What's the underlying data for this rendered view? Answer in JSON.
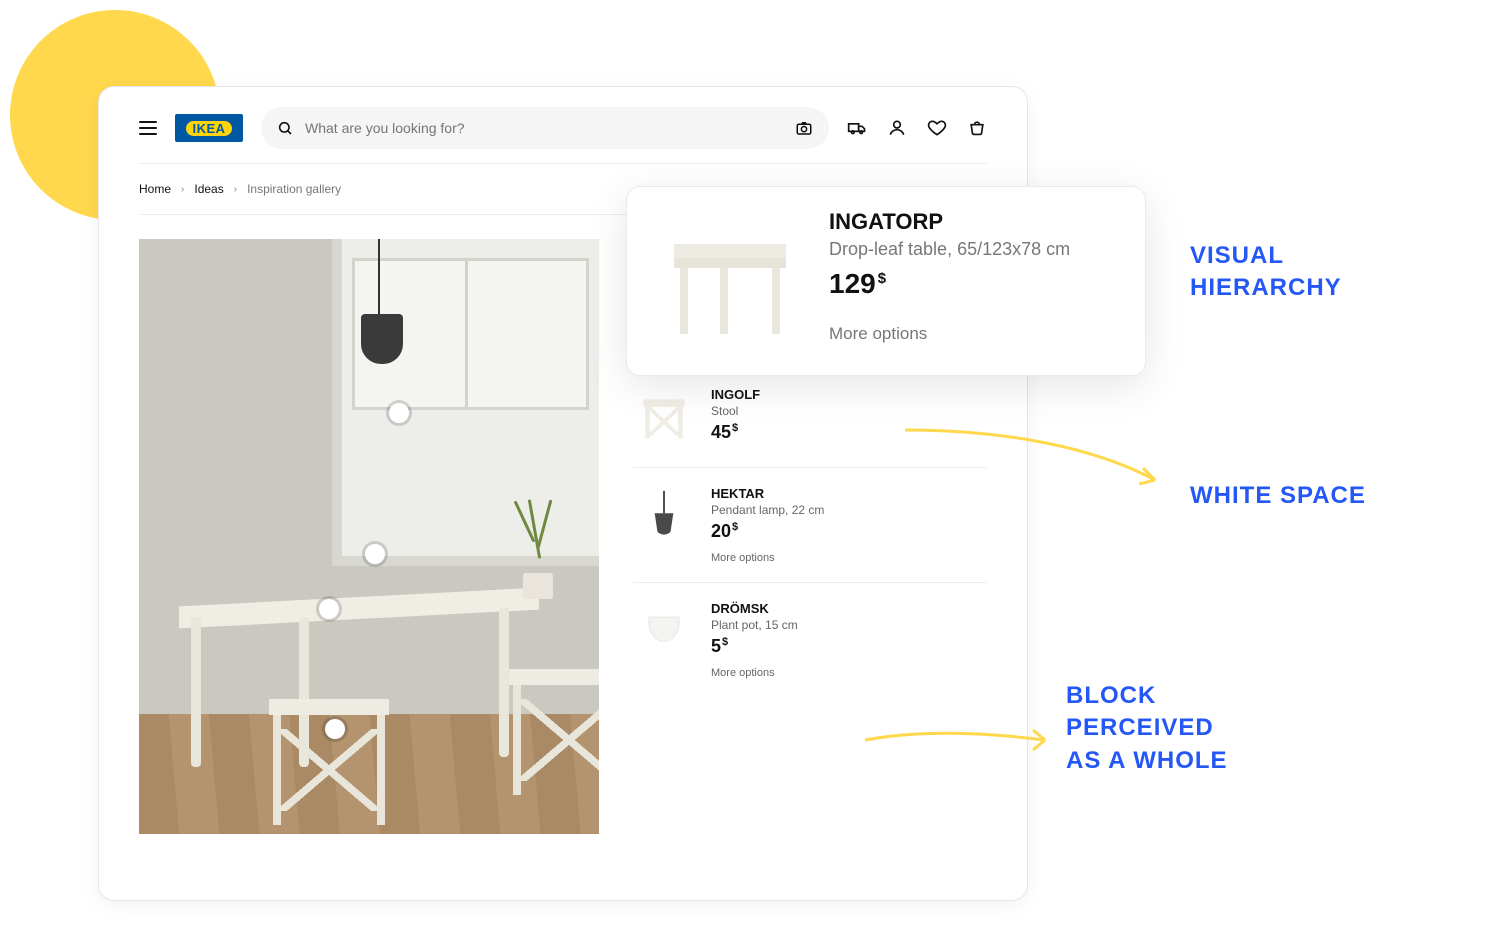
{
  "brand": "IKEA",
  "search": {
    "placeholder": "What are you looking for?"
  },
  "breadcrumb": {
    "home": "Home",
    "ideas": "Ideas",
    "current": "Inspiration gallery"
  },
  "popover": {
    "name": "INGATORP",
    "desc": "Drop-leaf table, 65/123x78 cm",
    "price": "129",
    "currency": "$",
    "more": "More options"
  },
  "products": [
    {
      "name": "INGOLF",
      "desc": "Stool",
      "price": "45",
      "currency": "$",
      "more": ""
    },
    {
      "name": "HEKTAR",
      "desc": "Pendant lamp, 22 cm",
      "price": "20",
      "currency": "$",
      "more": "More options"
    },
    {
      "name": "DRÖMSK",
      "desc": "Plant pot, 15 cm",
      "price": "5",
      "currency": "$",
      "more": "More options"
    }
  ],
  "annotations": {
    "a1_line1": "Visual",
    "a1_line2": "Hierarchy",
    "a2": "White Space",
    "a3_line1": "Block",
    "a3_line2": "Perceived",
    "a3_line3": "As a Whole"
  }
}
